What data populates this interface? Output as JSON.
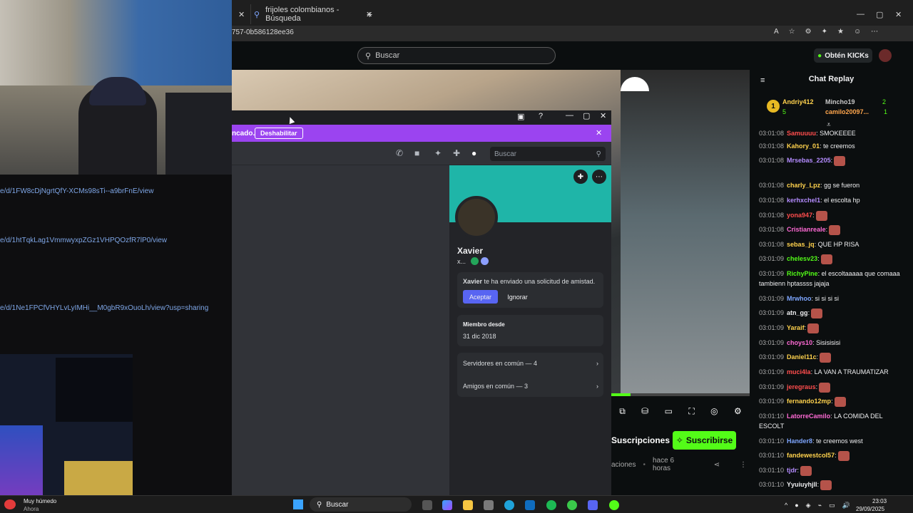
{
  "browser": {
    "tab_label": "frijoles colombianos - Búsqueda",
    "new_tab": "+",
    "url": "757-0b586128ee36"
  },
  "kick": {
    "search_placeholder": "Buscar",
    "get_kicks": "Obtén KICKs",
    "subscriptions": "Suscripciones",
    "subscribe": "Suscribirse",
    "meta_tag": "aciones",
    "meta_time": "hace 6 horas",
    "progress": 0.14
  },
  "discord": {
    "banner_text": "ncado.",
    "banner_button": "Deshabilitar",
    "search_placeholder": "Buscar",
    "profile": {
      "name": "Xavier",
      "handle": "x...",
      "request_user": "Xavier",
      "request_text": "te ha enviado una solicitud de amistad.",
      "accept": "Aceptar",
      "ignore": "Ignorar",
      "member_since_label": "Miembro desde",
      "member_since_value": "31 dic 2018",
      "servers": "Servidores en común — 4",
      "friends": "Amigos en común — 3"
    }
  },
  "links": [
    "e/d/1FW8cDjNgrtQfY-XCMs98sTi--a9brFnE/view",
    "e/d/1htTqkLag1VmmwyxpZGz1VHPQOzfR7lP0/view",
    "e/d/1Ne1FPCfVHYLvLyIMHi__M0gbR9xOuoLh/view?usp=sharing"
  ],
  "chat": {
    "title": "Chat Replay",
    "leaderboard": {
      "first": {
        "rank": "1",
        "name": "Andriy412",
        "count": "5"
      },
      "second": {
        "name": "Mincho19",
        "count": "2"
      },
      "third": {
        "name": "camilo20097...",
        "count": "1"
      }
    },
    "messages": [
      {
        "time": "03:01:08",
        "user": "Samuuuu",
        "color": "#ff4d4d",
        "text": ": SMOKEEEE"
      },
      {
        "time": "03:01:08",
        "user": "Kahory_01",
        "color": "#ffd24d",
        "text": ": te creemos"
      },
      {
        "time": "03:01:08",
        "user": "Mrsebas_2205",
        "color": "#b48cff",
        "text": ":"
      },
      {
        "time": "03:01:08",
        "user": "charly_Lpz",
        "color": "#ffd24d",
        "text": ": gg se fueron"
      },
      {
        "time": "03:01:08",
        "user": "kerhxchel1",
        "color": "#b48cff",
        "text": ": el escolta hp"
      },
      {
        "time": "03:01:08",
        "user": "yona947",
        "color": "#ff4d4d",
        "text": ":"
      },
      {
        "time": "03:01:08",
        "user": "Cristianreale",
        "color": "#ff6ad5",
        "text": ":"
      },
      {
        "time": "03:01:08",
        "user": "sebas_jq",
        "color": "#ffd24d",
        "text": ": QUE HP RISA"
      },
      {
        "time": "03:01:09",
        "user": "chelesv23",
        "color": "#53fc18",
        "text": ":"
      },
      {
        "time": "03:01:09",
        "user": "RichyPine",
        "color": "#53fc18",
        "text": ": el escoltaaaaa que comaaa tambienn hptassss jajaja"
      },
      {
        "time": "03:01:09",
        "user": "Mrwhoo",
        "color": "#7ea6ff",
        "text": ": si si si si"
      },
      {
        "time": "03:01:09",
        "user": "atn_gg",
        "color": "#efeff1",
        "text": ":"
      },
      {
        "time": "03:01:09",
        "user": "Yaraif",
        "color": "#ffd24d",
        "text": ":"
      },
      {
        "time": "03:01:09",
        "user": "choys10",
        "color": "#ff6ad5",
        "text": ": Sisisisisi"
      },
      {
        "time": "03:01:09",
        "user": "Daniel11c",
        "color": "#ffd24d",
        "text": ":"
      },
      {
        "time": "03:01:09",
        "user": "muci4la",
        "color": "#ff4d4d",
        "text": ": LA VAN A TRAUMATIZAR"
      },
      {
        "time": "03:01:09",
        "user": "jeregraus",
        "color": "#ff4d4d",
        "text": ":"
      },
      {
        "time": "03:01:09",
        "user": "fernando12mp",
        "color": "#ffd24d",
        "text": ":"
      },
      {
        "time": "03:01:10",
        "user": "LatorreCamilo",
        "color": "#ff6ad5",
        "text": ": LA COMIDA DEL ESCOLT"
      },
      {
        "time": "03:01:10",
        "user": "Hander8",
        "color": "#7ea6ff",
        "text": ": te creemos west"
      },
      {
        "time": "03:01:10",
        "user": "fandewestcol57",
        "color": "#ffd24d",
        "text": ":"
      },
      {
        "time": "03:01:10",
        "user": "tjdr",
        "color": "#b48cff",
        "text": ":"
      },
      {
        "time": "03:01:10",
        "user": "Yyuiuyhjll",
        "color": "#efeff1",
        "text": ":"
      }
    ]
  },
  "taskbar": {
    "weather": "Muy húmedo",
    "weather_sub": "Ahora",
    "search": "Buscar",
    "time": "23:03",
    "date": "29/09/2025"
  }
}
